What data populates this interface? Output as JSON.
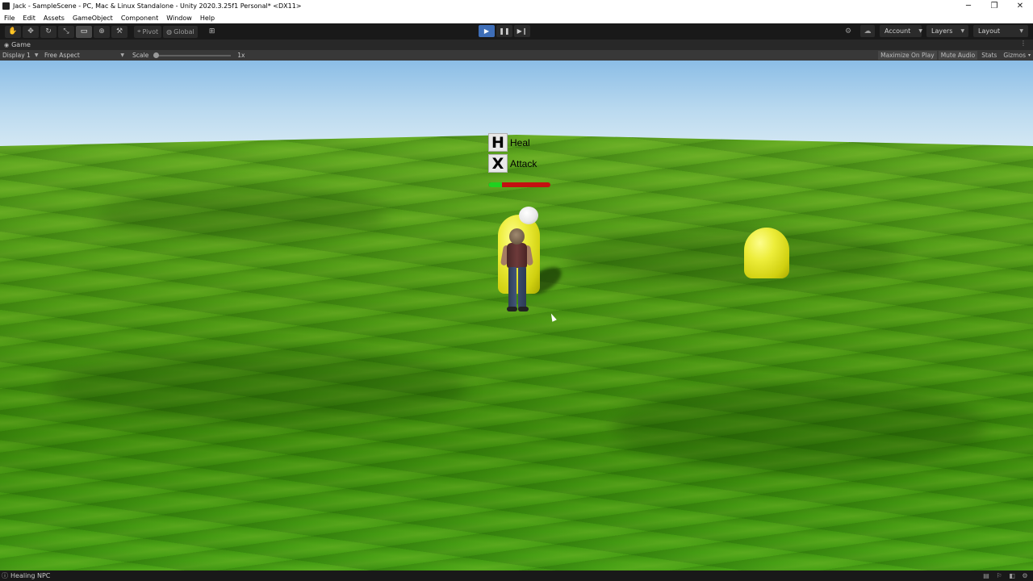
{
  "window": {
    "title": "Jack - SampleScene - PC, Mac & Linux Standalone - Unity 2020.3.25f1 Personal* <DX11>",
    "controls": {
      "minimize": "─",
      "maximize": "❐",
      "close": "✕"
    }
  },
  "menu": {
    "items": [
      {
        "label": "File"
      },
      {
        "label": "Edit"
      },
      {
        "label": "Assets"
      },
      {
        "label": "GameObject"
      },
      {
        "label": "Component"
      },
      {
        "label": "Window"
      },
      {
        "label": "Help"
      }
    ]
  },
  "toolbar": {
    "tools": [
      {
        "icon": "hand-tool-icon",
        "glyph": "✋"
      },
      {
        "icon": "move-tool-icon",
        "glyph": "✥"
      },
      {
        "icon": "rotate-tool-icon",
        "glyph": "↻"
      },
      {
        "icon": "scale-tool-icon",
        "glyph": "⤡"
      },
      {
        "icon": "rect-tool-icon",
        "glyph": "▭",
        "active": true
      },
      {
        "icon": "transform-tool-icon",
        "glyph": "⊕"
      },
      {
        "icon": "custom-tool-icon",
        "glyph": "⚒"
      }
    ],
    "pivot_label": "Pivot",
    "global_label": "Global",
    "grid_icon": "⊞",
    "play": {
      "play_glyph": "▶",
      "pause_glyph": "❚❚",
      "step_glyph": "▶❙"
    },
    "collab_glyph": "⚙",
    "cloud_glyph": "☁",
    "account_label": "Account",
    "layers_label": "Layers",
    "layout_label": "Layout"
  },
  "tab": {
    "label": "Game",
    "menu_glyph": "⋮"
  },
  "game_options": {
    "display": "Display 1",
    "aspect": "Free Aspect",
    "scale_label": "Scale",
    "scale_value": "1x",
    "scale_fraction": 0,
    "toggles": [
      {
        "label": "Maximize On Play",
        "boxed": true
      },
      {
        "label": "Mute Audio",
        "boxed": true
      },
      {
        "label": "Stats",
        "boxed": false
      },
      {
        "label": "Gizmos",
        "boxed": false
      }
    ],
    "gizmos_caret": "▾"
  },
  "game_ui": {
    "actions": [
      {
        "key": "H",
        "label": "Heal"
      },
      {
        "key": "X",
        "label": "Attack"
      }
    ],
    "health": {
      "fraction": 0.22,
      "fill_color": "#1fd11f",
      "empty_color": "#c41010"
    }
  },
  "status": {
    "text": "Healing NPC",
    "icon_glyph": "ⓘ"
  }
}
